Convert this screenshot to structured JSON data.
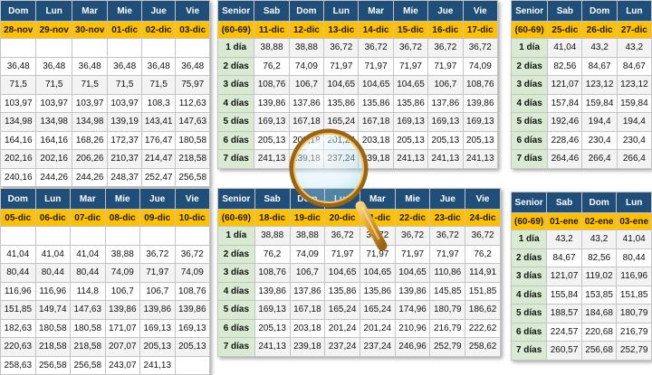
{
  "tables": [
    {
      "headers": [
        "Dom",
        "Lun",
        "Mar",
        "Mie",
        "Jue",
        "Vie"
      ],
      "dates": [
        "28-nov",
        "29-nov",
        "30-nov",
        "01-dic",
        "02-dic",
        "03-dic"
      ],
      "rows": [
        [
          "36,48",
          "36,48",
          "36,48",
          "36,48",
          "36,48",
          "36,48"
        ],
        [
          "71,5",
          "71,5",
          "71,5",
          "71,5",
          "71,5",
          "75,97"
        ],
        [
          "103,97",
          "103,97",
          "103,97",
          "103,97",
          "108,3",
          "112,63"
        ],
        [
          "134,98",
          "134,98",
          "134,98",
          "139,19",
          "143,41",
          "147,63"
        ],
        [
          "164,16",
          "164,16",
          "168,26",
          "172,37",
          "176,47",
          "180,58"
        ],
        [
          "202,16",
          "202,16",
          "206,26",
          "210,37",
          "214,47",
          "218,58"
        ],
        [
          "240,16",
          "244,26",
          "244,26",
          "248,37",
          "252,47",
          "256,58"
        ]
      ]
    },
    {
      "headers": [
        "Senior",
        "Sab",
        "Dom",
        "Lun",
        "Mar",
        "Mie",
        "Jue",
        "Vie"
      ],
      "dates": [
        "(60-69)",
        "11-dic",
        "12-dic",
        "13-dic",
        "14-dic",
        "15-dic",
        "16-dic",
        "17-dic"
      ],
      "labels": [
        "1 día",
        "2 días",
        "3 días",
        "4 días",
        "5 días",
        "6 días",
        "7 días"
      ],
      "rows": [
        [
          "38,88",
          "38,88",
          "36,72",
          "36,72",
          "36,72",
          "36,72",
          "36,72"
        ],
        [
          "76,2",
          "74,09",
          "71,97",
          "71,97",
          "71,97",
          "71,97",
          "74,09"
        ],
        [
          "108,76",
          "106,7",
          "104,65",
          "104,65",
          "104,65",
          "106,7",
          "108,76"
        ],
        [
          "139,86",
          "137,86",
          "135,86",
          "135,86",
          "135,86",
          "137,86",
          "139,86"
        ],
        [
          "169,13",
          "167,18",
          "165,24",
          "167,18",
          "169,13",
          "169,13",
          "169,13"
        ],
        [
          "205,13",
          "203,18",
          "201,24",
          "203,18",
          "205,13",
          "205,13",
          "205,13"
        ],
        [
          "241,13",
          "239,18",
          "237,24",
          "239,18",
          "241,13",
          "241,13",
          "241,13"
        ]
      ]
    },
    {
      "headers": [
        "Senior",
        "Sab",
        "Dom",
        "Lun"
      ],
      "dates": [
        "(60-69)",
        "25-dic",
        "26-dic",
        "27-dic"
      ],
      "labels": [
        "1 día",
        "2 días",
        "3 días",
        "4 días",
        "5 días",
        "6 días",
        "7 días"
      ],
      "rows": [
        [
          "41,04",
          "43,2",
          "43,2"
        ],
        [
          "82,56",
          "84,67",
          "84,67"
        ],
        [
          "121,07",
          "123,12",
          "123,12"
        ],
        [
          "157,84",
          "159,84",
          "159,84"
        ],
        [
          "192,46",
          "194,4",
          "194,4"
        ],
        [
          "228,46",
          "230,4",
          "230,4"
        ],
        [
          "264,46",
          "266,4",
          "266,4"
        ]
      ]
    },
    {
      "headers": [
        "Dom",
        "Lun",
        "Mar",
        "Mie",
        "Jue",
        "Vie"
      ],
      "dates": [
        "05-dic",
        "06-dic",
        "07-dic",
        "08-dic",
        "09-dic",
        "10-dic"
      ],
      "rows": [
        [
          "41,04",
          "41,04",
          "41,04",
          "38,88",
          "36,72",
          "36,72"
        ],
        [
          "80,44",
          "80,44",
          "80,44",
          "74,09",
          "71,97",
          "74,09"
        ],
        [
          "116,96",
          "116,96",
          "114,8",
          "106,7",
          "106,7",
          "108,76"
        ],
        [
          "151,85",
          "149,74",
          "147,63",
          "139,86",
          "139,86",
          "139,86"
        ],
        [
          "182,63",
          "180,58",
          "180,58",
          "171,07",
          "169,13",
          "169,13"
        ],
        [
          "220,63",
          "218,58",
          "218,58",
          "207,07",
          "205,13",
          "205,13"
        ],
        [
          "258,63",
          "256,58",
          "256,58",
          "243,07",
          "241,13",
          ""
        ]
      ]
    },
    {
      "headers": [
        "Senior",
        "Sab",
        "Dom",
        "Lun",
        "Mar",
        "Mie",
        "Jue",
        "Vie"
      ],
      "dates": [
        "(60-69)",
        "18-dic",
        "19-dic",
        "20-dic",
        "21-dic",
        "22-dic",
        "23-dic",
        "24-dic"
      ],
      "labels": [
        "1 día",
        "2 días",
        "3 días",
        "4 días",
        "5 días",
        "6 días",
        "7 días"
      ],
      "rows": [
        [
          "38,88",
          "38,88",
          "36,72",
          "36,72",
          "36,72",
          "36,72",
          "36,72"
        ],
        [
          "76,2",
          "74,09",
          "71,97",
          "71,97",
          "71,97",
          "71,97",
          "76,2"
        ],
        [
          "108,76",
          "106,7",
          "104,65",
          "104,65",
          "104,65",
          "110,86",
          "114,91"
        ],
        [
          "139,86",
          "137,86",
          "135,86",
          "135,86",
          "139,86",
          "145,85",
          "151,85"
        ],
        [
          "169,13",
          "167,18",
          "165,24",
          "165,24",
          "174,96",
          "180,79",
          "186,62"
        ],
        [
          "205,13",
          "203,18",
          "201,24",
          "201,24",
          "210,96",
          "216,79",
          "222,62"
        ],
        [
          "241,13",
          "239,18",
          "237,24",
          "237,24",
          "246,96",
          "252,79",
          "258,62"
        ]
      ]
    },
    {
      "headers": [
        "Senior",
        "Sab",
        "Dom",
        "Lun"
      ],
      "dates": [
        "(60-69)",
        "01-ene",
        "02-ene",
        "03-ene"
      ],
      "labels": [
        "1 día",
        "2 días",
        "3 días",
        "4 días",
        "5 días",
        "6 días",
        "7 días"
      ],
      "rows": [
        [
          "43,2",
          "43,2",
          "41,04"
        ],
        [
          "84,67",
          "82,56",
          "80,44"
        ],
        [
          "121,07",
          "119,02",
          "116,96"
        ],
        [
          "155,84",
          "153,85",
          "151,85"
        ],
        [
          "188,57",
          "184,68",
          "180,79"
        ],
        [
          "224,57",
          "220,68",
          "216,79"
        ],
        [
          "260,57",
          "256,68",
          "252,79"
        ]
      ]
    }
  ]
}
